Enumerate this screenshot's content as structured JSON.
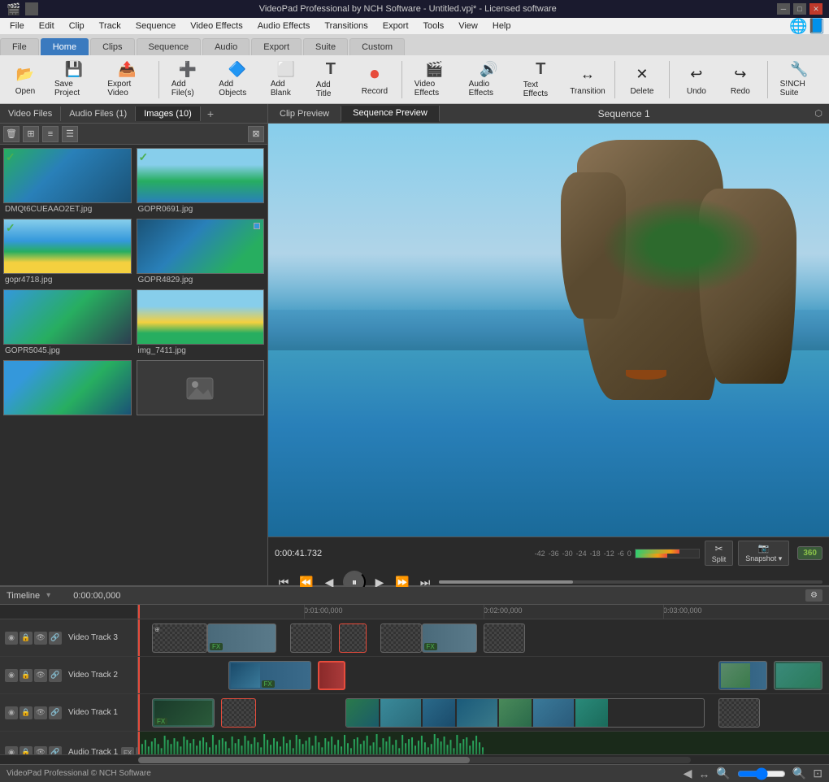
{
  "window": {
    "title": "VideoPad Professional by NCH Software - Untitled.vpj* - Licensed software"
  },
  "titlebar": {
    "minimize": "─",
    "maximize": "□",
    "close": "✕"
  },
  "menubar": {
    "items": [
      "File",
      "Edit",
      "Clip",
      "Track",
      "Sequence",
      "Video Effects",
      "Audio Effects",
      "Transitions",
      "Export",
      "Tools",
      "View",
      "Help"
    ]
  },
  "tabs": {
    "items": [
      "File",
      "Home",
      "Clips",
      "Sequence",
      "Audio",
      "Export",
      "Suite",
      "Custom"
    ]
  },
  "toolbar": {
    "buttons": [
      {
        "id": "open",
        "label": "Open",
        "icon": "📂"
      },
      {
        "id": "save-project",
        "label": "Save Project",
        "icon": "💾"
      },
      {
        "id": "export-video",
        "label": "Export Video",
        "icon": "📤"
      },
      {
        "id": "add-files",
        "label": "Add File(s)",
        "icon": "➕"
      },
      {
        "id": "add-objects",
        "label": "Add Objects",
        "icon": "🔷"
      },
      {
        "id": "add-blank",
        "label": "Add Blank",
        "icon": "⬜"
      },
      {
        "id": "add-title",
        "label": "Add Title",
        "icon": "T"
      },
      {
        "id": "record",
        "label": "Record",
        "icon": "⏺"
      },
      {
        "id": "video-effects",
        "label": "Video Effects",
        "icon": "🎬"
      },
      {
        "id": "audio-effects",
        "label": "Audio Effects",
        "icon": "🎵"
      },
      {
        "id": "text-effects",
        "label": "Text Effects",
        "icon": "T"
      },
      {
        "id": "transition",
        "label": "Transition",
        "icon": "↔"
      },
      {
        "id": "delete",
        "label": "Delete",
        "icon": "🗑"
      },
      {
        "id": "undo",
        "label": "Undo",
        "icon": "↩"
      },
      {
        "id": "redo",
        "label": "Redo",
        "icon": "↪"
      },
      {
        "id": "nch-suite",
        "label": "S!NCH Suite",
        "icon": "🔧"
      }
    ]
  },
  "left_panel": {
    "tabs": [
      "Video Files",
      "Audio Files (1)",
      "Images (10)"
    ],
    "active_tab": "Images (10)",
    "media_items": [
      {
        "id": "item1",
        "filename": "DMQt6CUEAAO2ET.jpg",
        "has_check": true,
        "thumb_class": "thumb-tropical1"
      },
      {
        "id": "item2",
        "filename": "GOPR0691.jpg",
        "has_check": true,
        "thumb_class": "thumb-tropical2"
      },
      {
        "id": "item3",
        "filename": "gopr4718.jpg",
        "has_check": true,
        "thumb_class": "thumb-beach1"
      },
      {
        "id": "item4",
        "filename": "GOPR4829.jpg",
        "has_check": false,
        "thumb_class": "thumb-beach2"
      },
      {
        "id": "item5",
        "filename": "GOPR5045.jpg",
        "has_check": false,
        "thumb_class": "thumb-island1"
      },
      {
        "id": "item6",
        "filename": "img_7411.jpg",
        "has_check": false,
        "thumb_class": "thumb-img7"
      },
      {
        "id": "item7",
        "filename": "",
        "has_check": false,
        "thumb_class": "thumb-unknown"
      },
      {
        "id": "item8",
        "filename": "",
        "has_check": false,
        "thumb_class": "thumb-tropical1"
      }
    ]
  },
  "preview": {
    "clip_preview_label": "Clip Preview",
    "sequence_preview_label": "Sequence Preview",
    "sequence_title": "Sequence 1",
    "time": "0:00:41.732"
  },
  "timeline": {
    "title": "Timeline",
    "current_time": "0:00:00,000",
    "markers": [
      "0:01:00,000",
      "0:02:00,000",
      "0:03:00,000"
    ],
    "tracks": [
      {
        "name": "Video Track 3",
        "type": "video"
      },
      {
        "name": "Video Track 2",
        "type": "video"
      },
      {
        "name": "Video Track 1",
        "type": "video"
      },
      {
        "name": "Audio Track 1",
        "type": "audio"
      }
    ]
  },
  "statusbar": {
    "text": "VideoPad Professional © NCH Software"
  }
}
